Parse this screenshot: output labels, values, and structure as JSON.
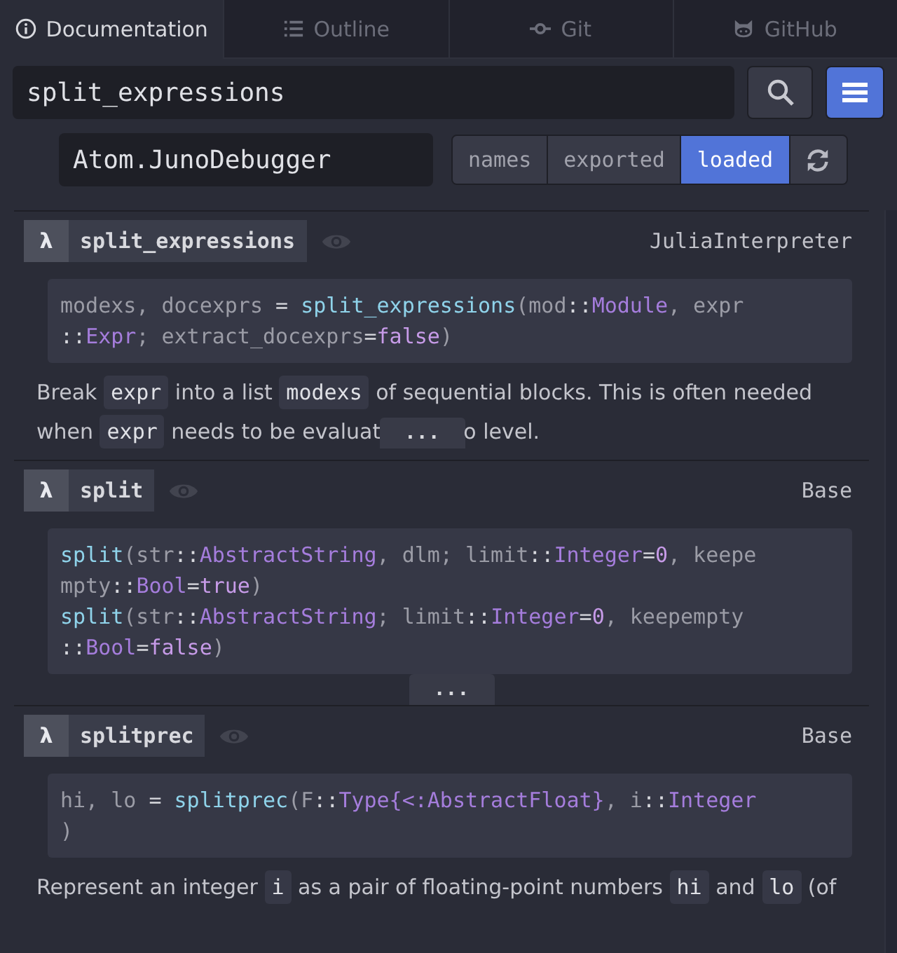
{
  "tabs": [
    {
      "label": "Documentation",
      "kind": "info",
      "selected": true
    },
    {
      "label": "Outline",
      "kind": "list",
      "selected": false
    },
    {
      "label": "Git",
      "kind": "commit",
      "selected": false
    },
    {
      "label": "GitHub",
      "kind": "cat",
      "selected": false
    }
  ],
  "search": {
    "value": "split_expressions"
  },
  "module": {
    "value": "Atom.JunoDebugger"
  },
  "filters": [
    {
      "label": "names",
      "selected": false
    },
    {
      "label": "exported",
      "selected": false
    },
    {
      "label": "loaded",
      "selected": true
    }
  ],
  "results": [
    {
      "badge": "λ",
      "name": "split_expressions",
      "module": "JuliaInterpreter",
      "code": [
        [
          {
            "kind": "plain",
            "text": "modexs, docexprs "
          },
          {
            "kind": "op",
            "text": "="
          },
          {
            "kind": "fn",
            "text": " split_expressions"
          },
          {
            "kind": "plain",
            "text": "(mod"
          },
          {
            "kind": "op",
            "text": "::"
          },
          {
            "kind": "type",
            "text": "Module"
          },
          {
            "kind": "plain",
            "text": ", expr"
          }
        ],
        [
          {
            "kind": "op",
            "text": "::"
          },
          {
            "kind": "type",
            "text": "Expr"
          },
          {
            "kind": "plain",
            "text": "; extract_docexprs"
          },
          {
            "kind": "op",
            "text": "="
          },
          {
            "kind": "lit",
            "text": "false"
          },
          {
            "kind": "plain",
            "text": ")"
          }
        ]
      ],
      "description": [
        [
          {
            "kind": "text",
            "text": "Break "
          },
          {
            "kind": "code",
            "text": "expr"
          },
          {
            "kind": "text",
            "text": " into a list "
          },
          {
            "kind": "code",
            "text": "modexs"
          },
          {
            "kind": "text",
            "text": " of sequential blocks. This is often needed"
          }
        ],
        [
          {
            "kind": "text",
            "text": "when "
          },
          {
            "kind": "code",
            "text": "expr"
          },
          {
            "kind": "text",
            "text": " needs to be evaluat"
          },
          {
            "kind": "more",
            "text": "..."
          },
          {
            "kind": "text",
            "text": "o level."
          }
        ]
      ]
    },
    {
      "badge": "λ",
      "name": "split",
      "module": "Base",
      "code": [
        [
          {
            "kind": "fn",
            "text": "split"
          },
          {
            "kind": "plain",
            "text": "(str"
          },
          {
            "kind": "op",
            "text": "::"
          },
          {
            "kind": "type",
            "text": "AbstractString"
          },
          {
            "kind": "plain",
            "text": ", dlm; limit"
          },
          {
            "kind": "op",
            "text": "::"
          },
          {
            "kind": "type",
            "text": "Integer"
          },
          {
            "kind": "op",
            "text": "="
          },
          {
            "kind": "lit",
            "text": "0"
          },
          {
            "kind": "plain",
            "text": ", keepe"
          }
        ],
        [
          {
            "kind": "plain",
            "text": "mpty"
          },
          {
            "kind": "op",
            "text": "::"
          },
          {
            "kind": "type",
            "text": "Bool"
          },
          {
            "kind": "op",
            "text": "="
          },
          {
            "kind": "lit",
            "text": "true"
          },
          {
            "kind": "plain",
            "text": ")"
          }
        ],
        [
          {
            "kind": "fn",
            "text": "split"
          },
          {
            "kind": "plain",
            "text": "(str"
          },
          {
            "kind": "op",
            "text": "::"
          },
          {
            "kind": "type",
            "text": "AbstractString"
          },
          {
            "kind": "plain",
            "text": "; limit"
          },
          {
            "kind": "op",
            "text": "::"
          },
          {
            "kind": "type",
            "text": "Integer"
          },
          {
            "kind": "op",
            "text": "="
          },
          {
            "kind": "lit",
            "text": "0"
          },
          {
            "kind": "plain",
            "text": ", keepempty"
          }
        ],
        [
          {
            "kind": "op",
            "text": "::"
          },
          {
            "kind": "type",
            "text": "Bool"
          },
          {
            "kind": "op",
            "text": "="
          },
          {
            "kind": "lit",
            "text": "false"
          },
          {
            "kind": "plain",
            "text": ")"
          }
        ]
      ],
      "more": "..."
    },
    {
      "badge": "λ",
      "name": "splitprec",
      "module": "Base",
      "code": [
        [
          {
            "kind": "plain",
            "text": "hi, lo "
          },
          {
            "kind": "op",
            "text": "="
          },
          {
            "kind": "fn",
            "text": " splitprec"
          },
          {
            "kind": "plain",
            "text": "(F"
          },
          {
            "kind": "op",
            "text": "::"
          },
          {
            "kind": "type",
            "text": "Type{<:AbstractFloat}"
          },
          {
            "kind": "plain",
            "text": ", i"
          },
          {
            "kind": "op",
            "text": "::"
          },
          {
            "kind": "type",
            "text": "Integer"
          }
        ],
        [
          {
            "kind": "plain",
            "text": ")"
          }
        ]
      ],
      "description": [
        [
          {
            "kind": "text",
            "text": "Represent an integer "
          },
          {
            "kind": "code",
            "text": "i"
          },
          {
            "kind": "text",
            "text": " as a pair of floating-point numbers "
          },
          {
            "kind": "code",
            "text": "hi"
          },
          {
            "kind": "text",
            "text": " and "
          },
          {
            "kind": "code",
            "text": "lo"
          },
          {
            "kind": "text",
            "text": " (of"
          }
        ]
      ]
    }
  ]
}
